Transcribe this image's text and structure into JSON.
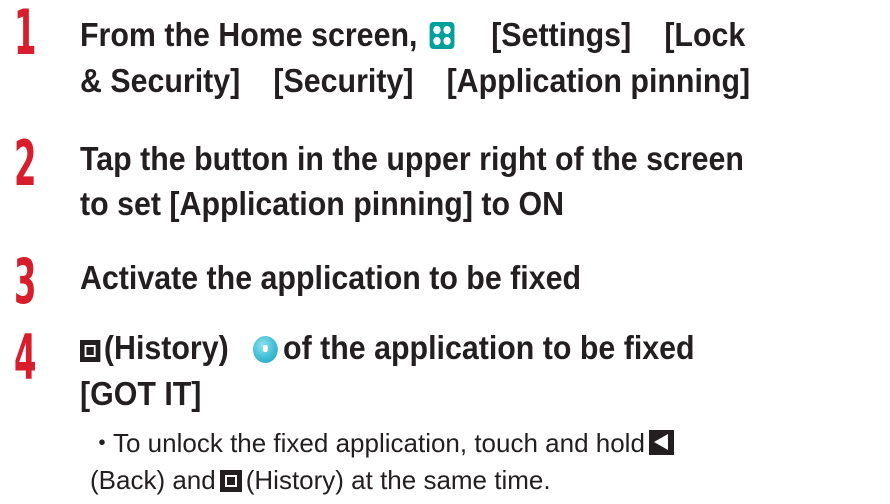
{
  "steps": [
    {
      "number": "1",
      "line1": {
        "lead": "From the Home screen,",
        "icon": "apps-grid-icon",
        "part2": "[Settings]",
        "part3": "[Lock"
      },
      "line2": {
        "part1": "& Security]",
        "part2": "[Security]",
        "part3": "[Application pinning]"
      }
    },
    {
      "number": "2",
      "line1": "Tap the button in the upper right of the screen",
      "line2": "to set [Application pinning] to ON"
    },
    {
      "number": "3",
      "line1": "Activate the application to be fixed"
    },
    {
      "number": "4",
      "line1": {
        "icon1": "history-square-icon",
        "part1": "(History)",
        "icon2": "pin-app-icon",
        "part2": "of the application to be fixed"
      },
      "line2": "[GOT IT]"
    }
  ],
  "note": {
    "bullet": "・",
    "line1_text": "To unlock the fixed application, touch and hold",
    "line1_icon": "back-triangle-icon",
    "line2_part1": "(Back) and",
    "line2_icon": "history-square-icon",
    "line2_part2": "(History) at the same time."
  },
  "colors": {
    "step_number": "#d81d2c",
    "text": "#231f20",
    "apps_icon": "#00a19a",
    "pin_icon": "#3fbdd3"
  }
}
